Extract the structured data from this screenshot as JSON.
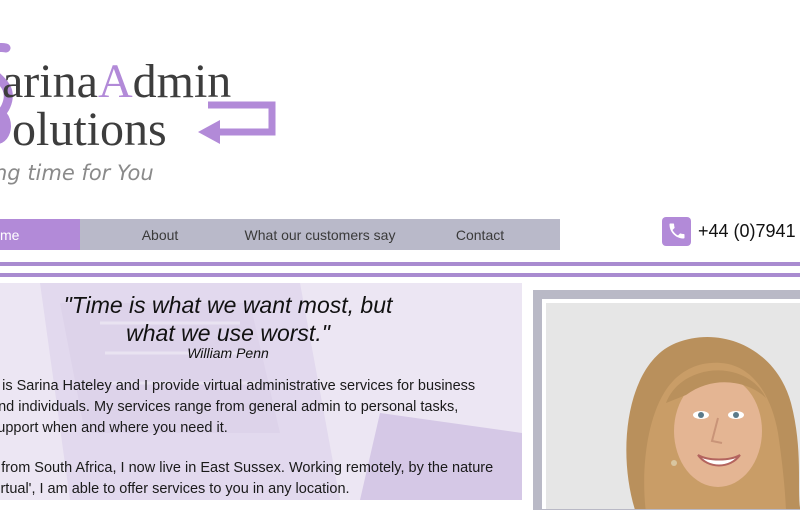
{
  "logo": {
    "line1_a": "arina",
    "line1_b": "A",
    "line1_c": "dmin",
    "line2": "olutions",
    "tagline": "ng time for You"
  },
  "nav": {
    "items": [
      {
        "label": "me"
      },
      {
        "label": "About"
      },
      {
        "label": "What our customers say"
      },
      {
        "label": "Contact"
      }
    ]
  },
  "contact": {
    "phone": "+44 (0)7941",
    "icon": "phone-icon"
  },
  "quote": {
    "line1": "\"Time is what we want most, but",
    "line2": "what we use worst.\"",
    "author": "William Penn"
  },
  "intro": {
    "para1": [
      "e is Sarina Hateley and I provide virtual administrative services for business",
      "and individuals. My services range from general admin to personal tasks,",
      " support when and where you need it."
    ],
    "para2": [
      "y from South Africa, I now live in East Sussex. Working remotely, by the nature",
      "virtual', I am able to offer services to you in any location."
    ]
  },
  "colors": {
    "accent": "#b28ad8",
    "nav_bg": "#b9b9c9",
    "rule": "#a98bd0",
    "panel_bg": "#ece6f3"
  }
}
